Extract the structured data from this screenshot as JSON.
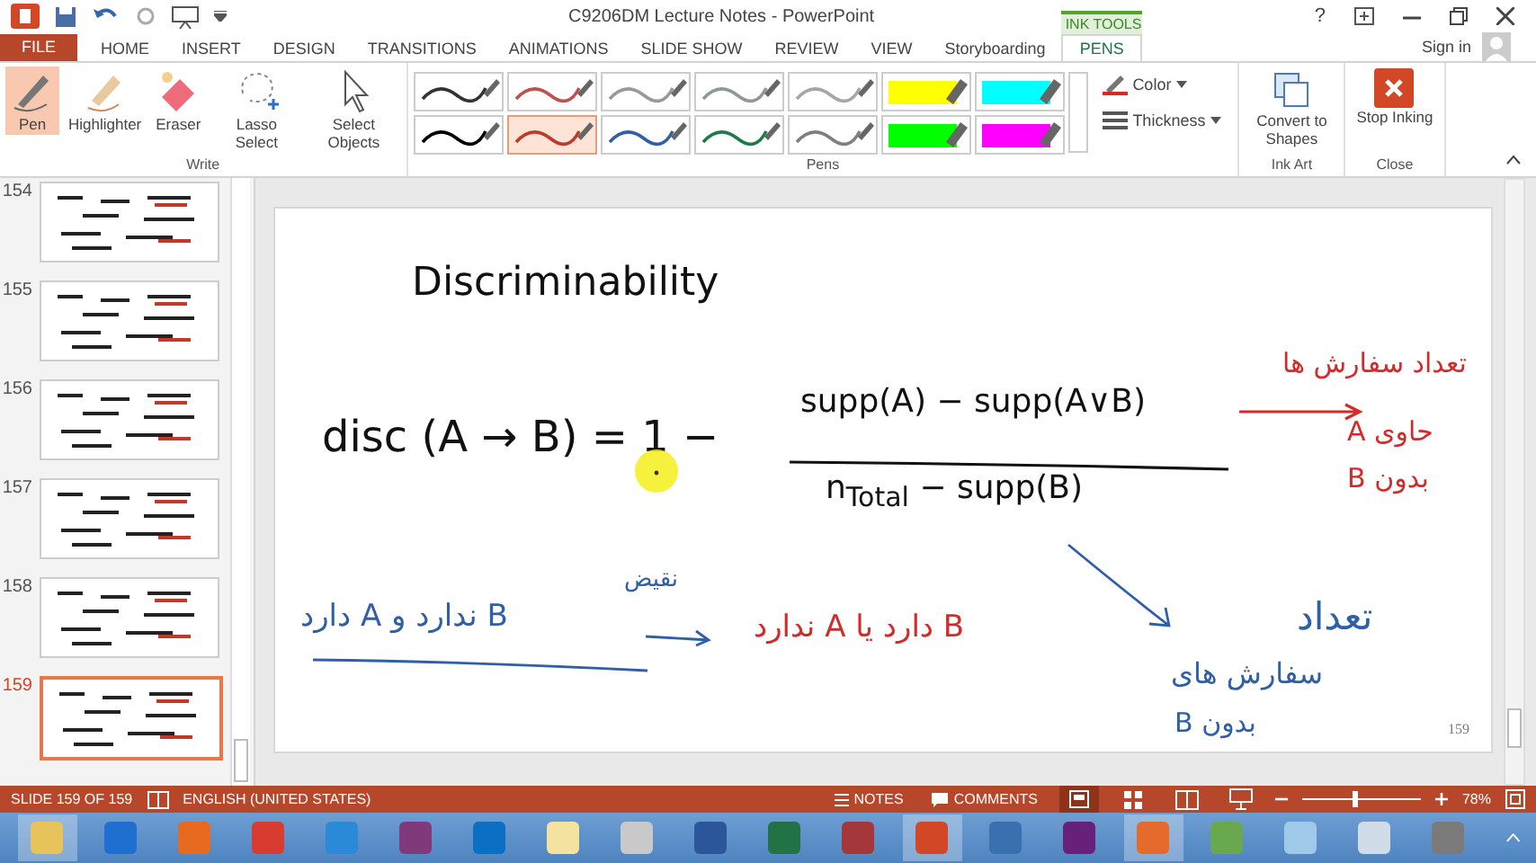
{
  "window": {
    "title": "C9206DM Lecture Notes - PowerPoint",
    "help": "?",
    "sign_in": "Sign in"
  },
  "contextual_group": "INK TOOLS",
  "tabs": [
    {
      "label": "FILE",
      "kind": "file",
      "selected": false
    },
    {
      "label": "HOME",
      "kind": "tab",
      "selected": false
    },
    {
      "label": "INSERT",
      "kind": "tab",
      "selected": false
    },
    {
      "label": "DESIGN",
      "kind": "tab",
      "selected": false
    },
    {
      "label": "TRANSITIONS",
      "kind": "tab",
      "selected": false
    },
    {
      "label": "ANIMATIONS",
      "kind": "tab",
      "selected": false
    },
    {
      "label": "SLIDE SHOW",
      "kind": "tab",
      "selected": false
    },
    {
      "label": "REVIEW",
      "kind": "tab",
      "selected": false
    },
    {
      "label": "VIEW",
      "kind": "tab",
      "selected": false
    },
    {
      "label": "Storyboarding",
      "kind": "tab",
      "selected": false
    },
    {
      "label": "PENS",
      "kind": "tab",
      "selected": true
    }
  ],
  "ribbon": {
    "write": {
      "label": "Write",
      "tools": [
        {
          "label": "Pen",
          "kind": "pen",
          "selected": true
        },
        {
          "label": "Highlighter",
          "kind": "highlighter",
          "selected": false
        },
        {
          "label": "Eraser",
          "kind": "eraser",
          "selected": false
        },
        {
          "label": "Lasso Select",
          "kind": "lasso",
          "selected": false
        },
        {
          "label": "Select Objects",
          "kind": "select",
          "selected": false
        }
      ]
    },
    "pens": {
      "label": "Pens",
      "items": [
        {
          "kind": "pen",
          "color": "#333333",
          "selected": false
        },
        {
          "kind": "pen",
          "color": "#c0504d",
          "selected": false
        },
        {
          "kind": "pen",
          "color": "#999999",
          "selected": false
        },
        {
          "kind": "pen",
          "color": "#8f9a8f",
          "selected": false
        },
        {
          "kind": "pen",
          "color": "#a6a6a6",
          "selected": false
        },
        {
          "kind": "highlighter",
          "color": "#ffff00",
          "selected": false
        },
        {
          "kind": "highlighter",
          "color": "#00ffff",
          "selected": false
        },
        {
          "kind": "pen",
          "color": "#000000",
          "selected": false
        },
        {
          "kind": "pen",
          "color": "#c0392b",
          "selected": true
        },
        {
          "kind": "pen",
          "color": "#2e5fa8",
          "selected": false
        },
        {
          "kind": "pen",
          "color": "#1e7b4a",
          "selected": false
        },
        {
          "kind": "pen",
          "color": "#7f7f7f",
          "selected": false
        },
        {
          "kind": "highlighter",
          "color": "#00ff00",
          "selected": false
        },
        {
          "kind": "highlighter",
          "color": "#ff00ff",
          "selected": false
        }
      ],
      "color_label": "Color",
      "thickness_label": "Thickness"
    },
    "ink_art": {
      "label": "Ink Art",
      "button": "Convert to Shapes"
    },
    "close": {
      "label": "Close",
      "button": "Stop Inking"
    }
  },
  "thumbnails": [
    {
      "number": "154",
      "selected": false
    },
    {
      "number": "155",
      "selected": false
    },
    {
      "number": "156",
      "selected": false
    },
    {
      "number": "157",
      "selected": false
    },
    {
      "number": "158",
      "selected": false
    },
    {
      "number": "159",
      "selected": true
    }
  ],
  "slide": {
    "ink": [
      {
        "text": "Discriminability",
        "color": "#111111"
      },
      {
        "text": "disc (A → B)   = 1 −",
        "color": "#111111"
      },
      {
        "text": "supp(A) − supp(A∨B)",
        "color": "#111111"
      },
      {
        "text": "n$_{Total}$ − supp(B)",
        "color": "#111111"
      },
      {
        "text": "تعداد سفارش ها",
        "color": "#d42a2a"
      },
      {
        "text": "حاوی A",
        "color": "#d42a2a"
      },
      {
        "text": "بدون B",
        "color": "#d42a2a"
      },
      {
        "text": "B ندارد و A دارد",
        "color": "#2e5fa8"
      },
      {
        "text": "نقیض",
        "color": "#2e5fa8"
      },
      {
        "text": "B دارد یا A ندارد",
        "color": "#d42a2a"
      },
      {
        "text": "تعداد",
        "color": "#2e5fa8"
      },
      {
        "text": "سفارش های",
        "color": "#2e5fa8"
      },
      {
        "text": "بدون B",
        "color": "#2e5fa8"
      }
    ],
    "number": "159"
  },
  "status_bar": {
    "slide": "SLIDE 159 OF 159",
    "language": "ENGLISH (UNITED STATES)",
    "notes": "NOTES",
    "comments": "COMMENTS",
    "zoom": {
      "level": 0.42,
      "reading": "78%"
    }
  },
  "taskbar": [
    {
      "color": "#e8c25a",
      "selected": true
    },
    {
      "color": "#1e6fd0",
      "selected": false
    },
    {
      "color": "#e66a1f",
      "selected": false
    },
    {
      "color": "#d83b2f",
      "selected": false
    },
    {
      "color": "#2a8ad8",
      "selected": false
    },
    {
      "color": "#80397b",
      "selected": false
    },
    {
      "color": "#0b6fc4",
      "selected": false
    },
    {
      "color": "#f3e2a0",
      "selected": false
    },
    {
      "color": "#c9c9c9",
      "selected": false
    },
    {
      "color": "#2b579a",
      "selected": false
    },
    {
      "color": "#217346",
      "selected": false
    },
    {
      "color": "#a4373a",
      "selected": false
    },
    {
      "color": "#d24726",
      "selected": true
    },
    {
      "color": "#3a6fb0",
      "selected": false
    },
    {
      "color": "#68217a",
      "selected": false
    },
    {
      "color": "#e56a2c",
      "selected": true
    },
    {
      "color": "#6aa84f",
      "selected": false
    },
    {
      "color": "#9fc9e8",
      "selected": false
    },
    {
      "color": "#d0dce8",
      "selected": false
    },
    {
      "color": "#7a7a7a",
      "selected": false
    }
  ]
}
